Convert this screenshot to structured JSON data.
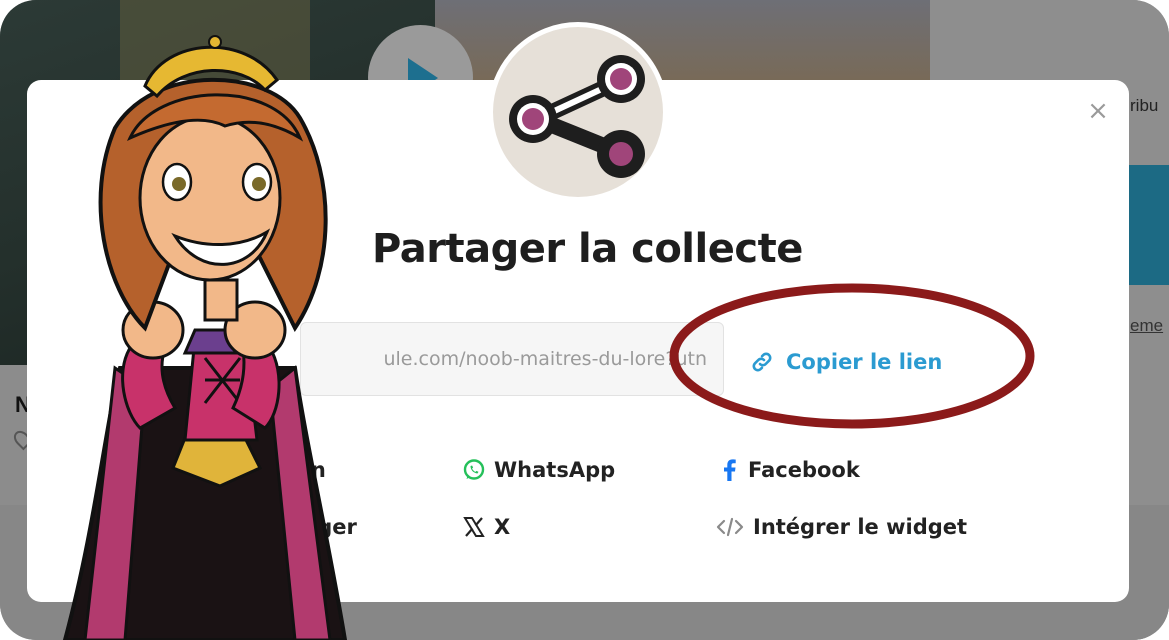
{
  "background": {
    "attribution_fragment": "ribu",
    "link_fragment": "eme",
    "card_title_fragment": "N"
  },
  "modal": {
    "close_symbol": "×",
    "title": "Partager la collecte",
    "link_value": "ule.com/noob-maitres-du-lore?utn",
    "copy_label": "Copier le lien",
    "share_options": {
      "linkedin": "dIn",
      "messenger": "enger",
      "whatsapp": "WhatsApp",
      "x": "X",
      "facebook": "Facebook",
      "widget": "Intégrer le widget"
    }
  },
  "colors": {
    "accent_blue": "#2b9bd1",
    "whatsapp_green": "#25c05a",
    "facebook_blue": "#1877f2",
    "highlight_red": "#8b1a1a",
    "share_icon_pink": "#a0457a"
  },
  "icons": {
    "share": "share-nodes-icon",
    "copy": "link-chain-icon",
    "whatsapp": "whatsapp-icon",
    "facebook": "facebook-icon",
    "x": "x-logo-icon",
    "widget": "code-brackets-icon",
    "close": "close-icon"
  }
}
